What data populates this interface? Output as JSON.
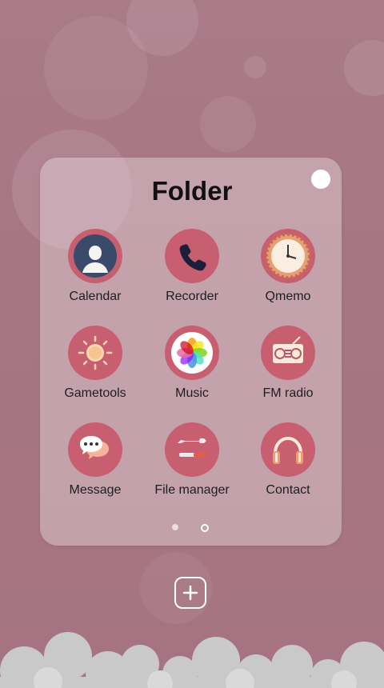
{
  "folder": {
    "title": "Folder"
  },
  "apps": [
    {
      "label": "Calendar",
      "icon": "contact-silhouette-icon"
    },
    {
      "label": "Recorder",
      "icon": "phone-handset-icon"
    },
    {
      "label": "Qmemo",
      "icon": "clock-icon"
    },
    {
      "label": "Gametools",
      "icon": "sun-icon"
    },
    {
      "label": "Music",
      "icon": "photos-flower-icon"
    },
    {
      "label": "FM radio",
      "icon": "radio-icon"
    },
    {
      "label": "Message",
      "icon": "chat-bubble-icon"
    },
    {
      "label": "File manager",
      "icon": "tools-icon"
    },
    {
      "label": "Contact",
      "icon": "headphones-icon"
    }
  ],
  "pagination": {
    "pages": 2,
    "current": 2
  },
  "colors": {
    "icon_bg": "#c85f71",
    "background": "#a77684"
  }
}
